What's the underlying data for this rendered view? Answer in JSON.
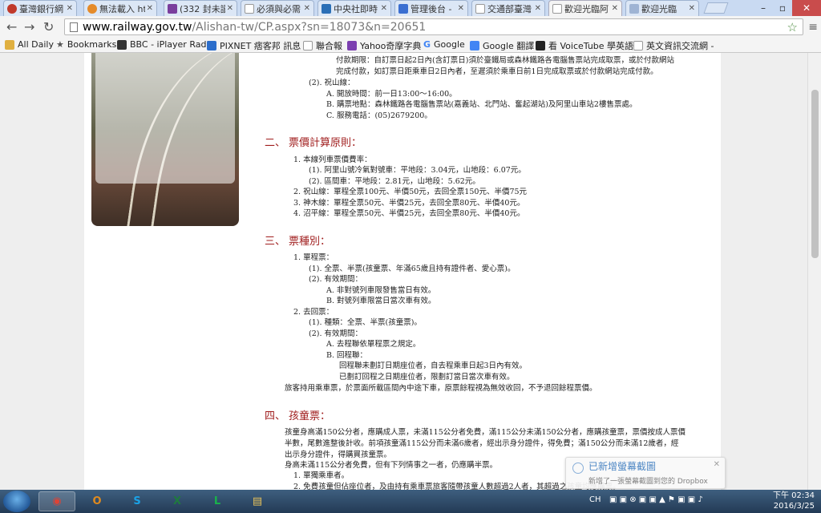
{
  "browser": {
    "tabs": [
      {
        "title": "臺灣銀行網",
        "color": "#c0392b"
      },
      {
        "title": "無法載入 htt",
        "color": "#e58b2a"
      },
      {
        "title": "(332 封未讀",
        "color": "#7a3e9d"
      },
      {
        "title": "必須與必需",
        "color": "#c8c8c8"
      },
      {
        "title": "中央社即時",
        "color": "#2b6fb6"
      },
      {
        "title": "管理後台 -",
        "color": "#3b6fd1"
      },
      {
        "title": "交通部臺灣",
        "color": "#9aa7b8"
      },
      {
        "title": "歡迎光臨阿",
        "color": "#ffffff"
      },
      {
        "title": "歡迎光臨",
        "color": "#9fb4d4"
      }
    ],
    "active_tab": 7,
    "url_host": "www.railway.gov.tw",
    "url_path": "/Alishan-tw/CP.aspx?sn=18073&n=20651",
    "bookmarks": [
      {
        "label": "All Daily",
        "color": "#e0b040"
      },
      {
        "label": "Bookmarks",
        "color": "#555555"
      },
      {
        "label": "BBC - iPlayer Radio",
        "color": "#333333"
      },
      {
        "label": "PIXNET 痞客邦 訊息",
        "color": "#2c6ecb"
      },
      {
        "label": "聯合報",
        "color": "#c8c8c8"
      },
      {
        "label": "Yahoo奇摩字典",
        "color": "#7b3fb0"
      },
      {
        "label": "Google",
        "color": "#4285f4"
      },
      {
        "label": "Google 翻譯",
        "color": "#4285f4"
      },
      {
        "label": "看 VoiceTube 學英語",
        "color": "#222222"
      },
      {
        "label": "英文資訊交流網 -",
        "color": "#c8c8c8"
      }
    ]
  },
  "article": {
    "pre_lines": [
      "付款期限：自訂票日起2日內(含訂票日)須於臺鐵局或森林鐵路各電腦售票站完成取票，或於付款網站",
      "完成付款，如訂票日距乘車日2日內者，至遲須於乘車日前1日完成取票或於付款網站完成付款。",
      "(2). 祝山線：",
      "A.   開放時間：前一日13:00～16:00。",
      "B.   購票地點：森林鐵路各電腦售票站(嘉義站、北門站、奮起湖站)及阿里山車站2樓售票處。",
      "C.   服務電話：(05)2679200。"
    ],
    "section2": {
      "number": "二、",
      "title": "票價計算原則：",
      "lines": [
        "1.   本線列車票價費率：",
        "(1). 阿里山號冷氣對號車：平地段：3.04元，山地段：6.07元。",
        "(2). 區間車：平地段：2.81元，山地段：5.62元。",
        "2.   祝山線：單程全票100元、半價50元，去回全票150元、半價75元",
        "3.   神木線：單程全票50元、半價25元，去回全票80元、半價40元。",
        "4.   沼平線：單程全票50元、半價25元，去回全票80元、半價40元。"
      ]
    },
    "section3": {
      "number": "三、",
      "title": "票種別：",
      "lines": [
        "1.   單程票：",
        "(1). 全票、半票(孩童票、年滿65歲且持有證件者、愛心票)。",
        "(2). 有效期間：",
        "A.   非對號列車限發售當日有效。",
        "B.   對號列車限當日當次車有效。",
        "2.   去回票：",
        "(1). 種類：全票、半票(孩童票)。",
        "(2). 有效期間：",
        "A.   去程聯依單程票之規定。",
        "B.   回程聯：",
        "回程聯未劃訂日期座位者，自去程乘車日起3日內有效。",
        "已劃訂回程之日期座位者，限劃訂當日當次車有效。",
        "旅客持用乘車票，於票面所載區間內中途下車，原票餘程視為無效收回，不予退回餘程票價。"
      ]
    },
    "section4": {
      "number": "四、",
      "title": "孩童票：",
      "lines": [
        "孩童身高滿150公分者，應購成人票，未滿115公分者免費，滿115公分未滿150公分者，應購孩童票，票價按成人票價",
        "半數，尾數進整後計收。前項孩童滿115公分而未滿6歲者，經出示身分證件，得免費；滿150公分而未滿12歲者，經",
        "出示身分證件，得購買孩童票。",
        "身高未滿115公分者免費，但有下列情事之一者，仍應購半票。",
        "1.   單獨乘車者。",
        "2.   免費孩童但佔座位者，及由持有乘車票旅客隨帶孩童人數超過2人者，其超過之孩童均應購票。"
      ]
    }
  },
  "toast": {
    "title": "已新增螢幕截圖",
    "message": "新增了一張螢幕截圖到您的 Dropbox"
  },
  "taskbar": {
    "ime": "CH",
    "time": "下午 02:34",
    "date": "2016/3/25",
    "apps": [
      {
        "name": "chrome",
        "glyph": "◉",
        "color": "#db4437"
      },
      {
        "name": "outlook",
        "glyph": "O",
        "color": "#e08a1e"
      },
      {
        "name": "skype",
        "glyph": "S",
        "color": "#1aa3e8"
      },
      {
        "name": "excel",
        "glyph": "X",
        "color": "#1f7a3f"
      },
      {
        "name": "line",
        "glyph": "L",
        "color": "#19b34b"
      },
      {
        "name": "explorer",
        "glyph": "▤",
        "color": "#e8c25a"
      }
    ]
  }
}
